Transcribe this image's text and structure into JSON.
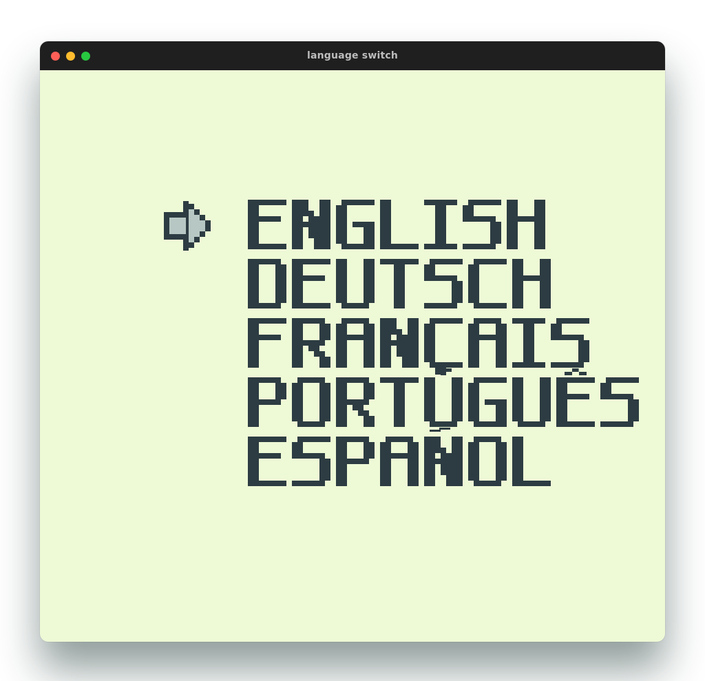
{
  "window": {
    "title": "language switch"
  },
  "selector": {
    "icon": "arrow-right-icon"
  },
  "languages": [
    {
      "label": "ENGLISH",
      "selected": true
    },
    {
      "label": "DEUTSCH",
      "selected": false
    },
    {
      "label": "FRANÇAIS",
      "selected": false
    },
    {
      "label": "PORTUGUÊS",
      "selected": false
    },
    {
      "label": "ESPAÑOL",
      "selected": false
    }
  ],
  "colors": {
    "lcd_bg": "#eef9d6",
    "lcd_fg": "#2d3c42",
    "arrow_fill": "#b7c7c3"
  }
}
